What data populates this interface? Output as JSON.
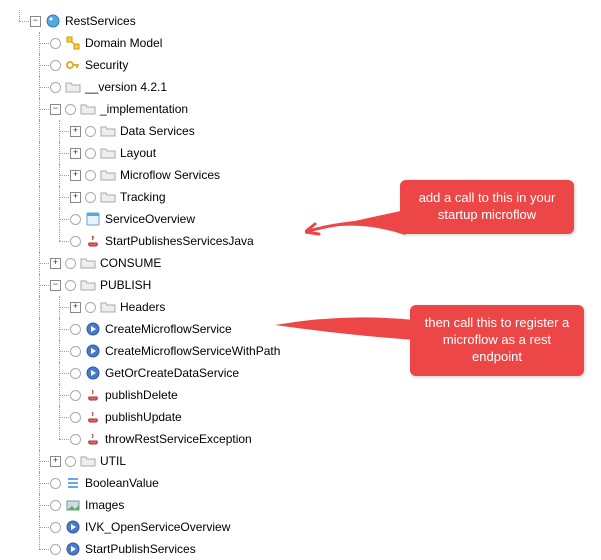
{
  "tree": {
    "root": "RestServices",
    "items": [
      "Domain Model",
      "Security",
      "__version 4.2.1",
      "_implementation",
      "Data Services",
      "Layout",
      "Microflow Services",
      "Tracking",
      "ServiceOverview",
      "StartPublishesServicesJava",
      "CONSUME",
      "PUBLISH",
      "Headers",
      "CreateMicroflowService",
      "CreateMicroflowServiceWithPath",
      "GetOrCreateDataService",
      "publishDelete",
      "publishUpdate",
      "throwRestServiceException",
      "UTIL",
      "BooleanValue",
      "Images",
      "IVK_OpenServiceOverview",
      "StartPublishServices"
    ]
  },
  "callouts": {
    "c1": "add a call to this in your startup microflow",
    "c2": "then call this to register a microflow as a rest endpoint"
  }
}
